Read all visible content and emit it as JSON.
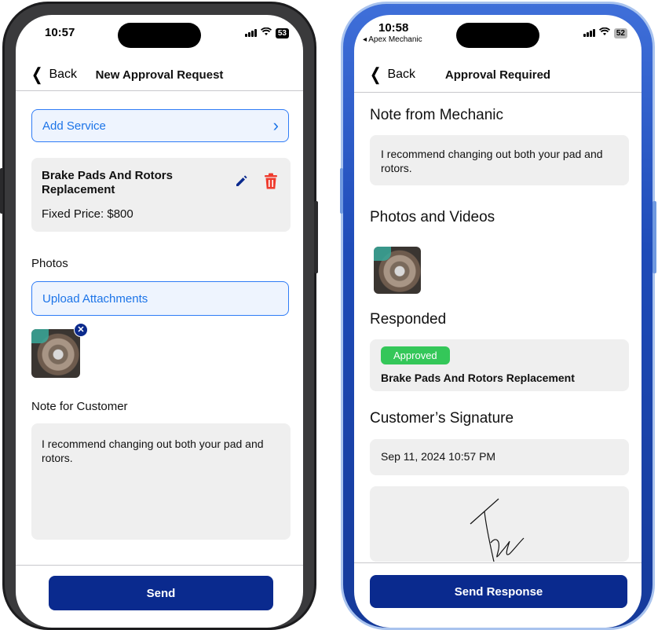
{
  "left": {
    "status_time": "10:57",
    "battery": "53",
    "nav": {
      "back_label": "Back",
      "title": "New Approval Request"
    },
    "add_service_label": "Add Service",
    "service": {
      "name": "Brake Pads And Rotors Replacement",
      "price": "Fixed Price: $800"
    },
    "photos_label": "Photos",
    "upload_label": "Upload Attachments",
    "note_label": "Note for Customer",
    "note_text": "I recommend changing out both your pad and rotors.",
    "send_label": "Send"
  },
  "right": {
    "status_time": "10:58",
    "back_app": "◂ Apex Mechanic",
    "battery": "52",
    "nav": {
      "back_label": "Back",
      "title": "Approval Required"
    },
    "note_heading": "Note from Mechanic",
    "note_text": "I recommend changing out both your pad and rotors.",
    "photos_heading": "Photos and Videos",
    "responded_heading": "Responded",
    "status_badge": "Approved",
    "service_name": "Brake Pads And Rotors Replacement",
    "signature_heading": "Customer’s Signature",
    "signature_date": "Sep 11, 2024 10:57 PM",
    "send_label": "Send Response"
  },
  "colors": {
    "primary": "#0a2a8e",
    "link": "#1c74e8",
    "danger": "#ef3b2d",
    "success": "#34c759"
  },
  "icons": [
    "chevron-left-icon",
    "chevron-right-icon",
    "pencil-icon",
    "trash-icon",
    "close-icon",
    "wifi-icon",
    "signal-icon",
    "battery-icon"
  ]
}
